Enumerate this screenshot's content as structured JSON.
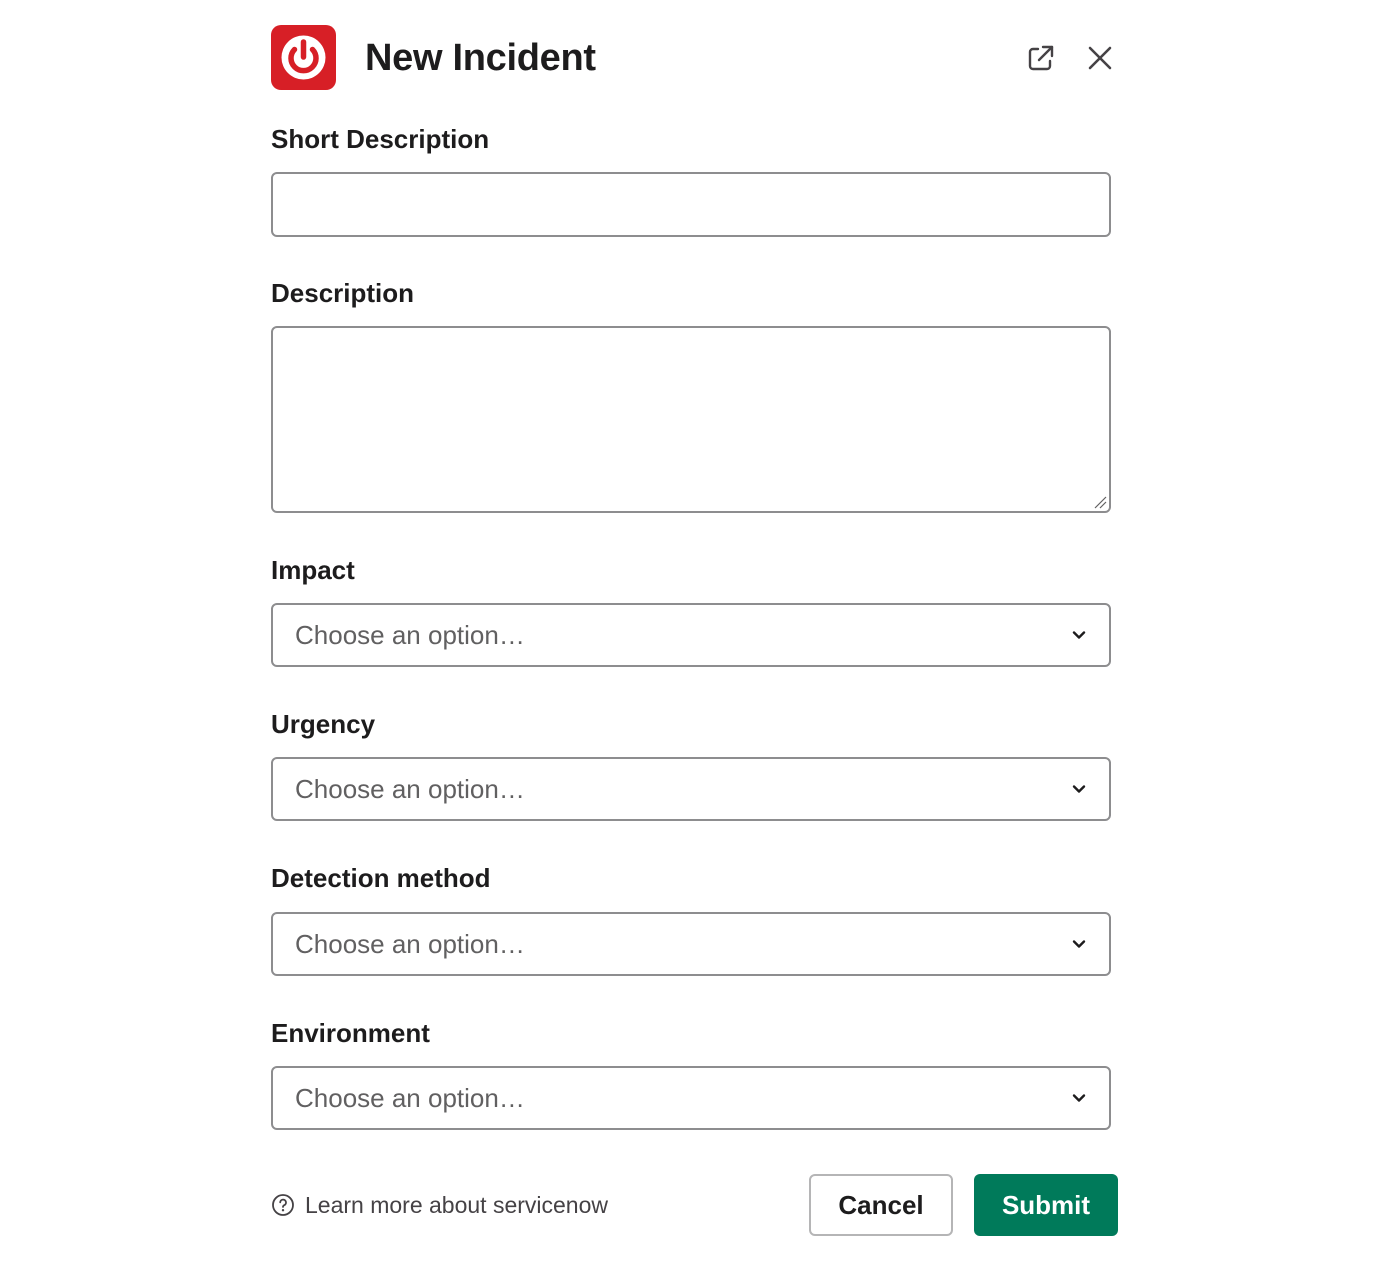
{
  "modal": {
    "title": "New Incident",
    "brand_color": "#d71f26",
    "app_icon": "power-icon",
    "header_actions": [
      "external-link-icon",
      "close-icon"
    ]
  },
  "fields": {
    "short_description": {
      "label": "Short Description",
      "value": ""
    },
    "description": {
      "label": "Description",
      "value": ""
    },
    "impact": {
      "label": "Impact",
      "placeholder": "Choose an option…"
    },
    "urgency": {
      "label": "Urgency",
      "placeholder": "Choose an option…"
    },
    "detection_method": {
      "label": "Detection method",
      "placeholder": "Choose an option…"
    },
    "environment": {
      "label": "Environment",
      "placeholder": "Choose an option…"
    }
  },
  "footer": {
    "help_link": "Learn more about servicenow",
    "cancel_label": "Cancel",
    "submit_label": "Submit",
    "submit_color": "#007a5a"
  }
}
